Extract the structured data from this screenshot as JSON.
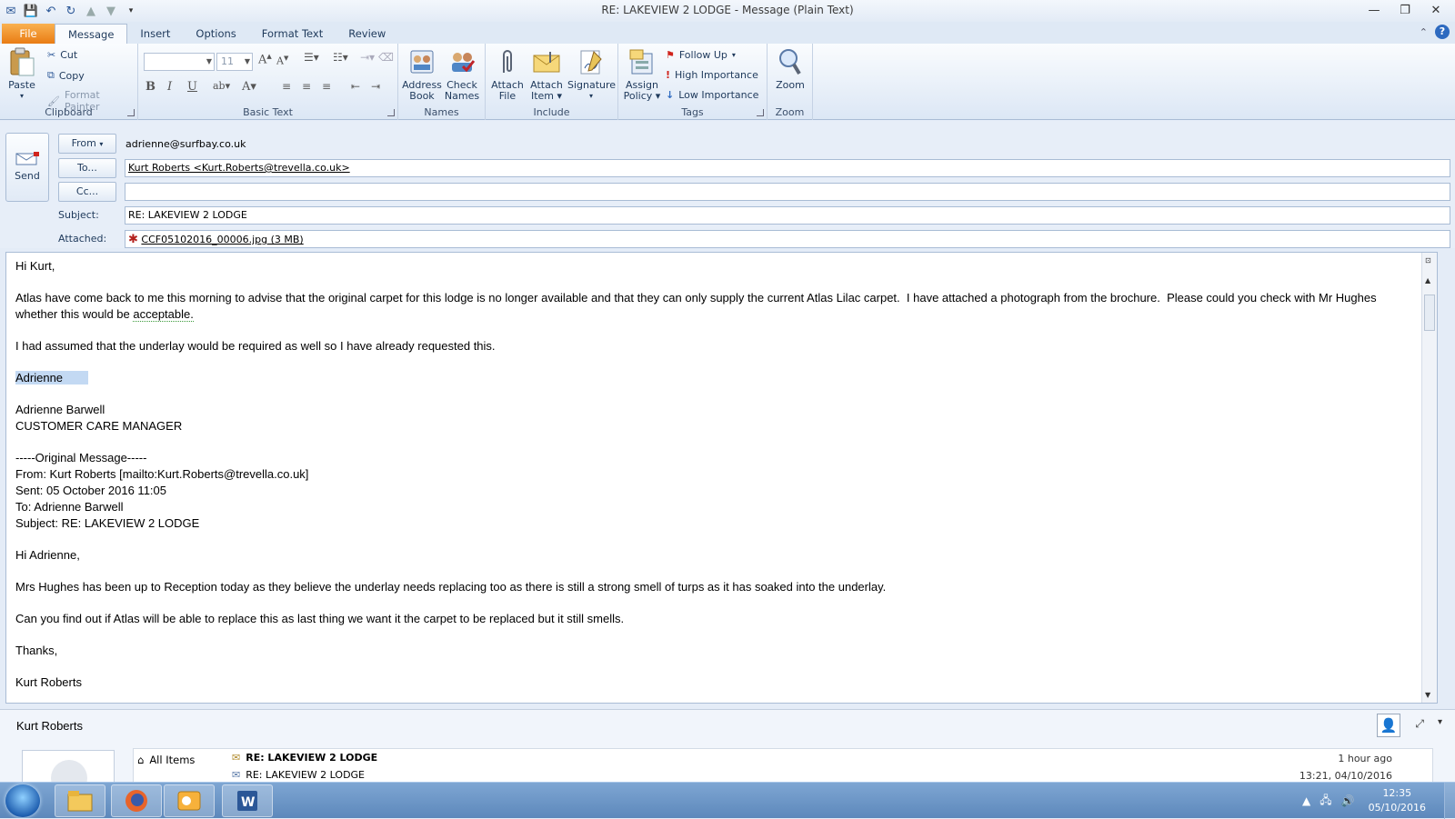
{
  "window": {
    "title": "RE: LAKEVIEW 2 LODGE  -  Message (Plain Text)"
  },
  "tabs": [
    "File",
    "Message",
    "Insert",
    "Options",
    "Format Text",
    "Review"
  ],
  "ribbon": {
    "clipboard": {
      "label": "Clipboard",
      "paste": "Paste",
      "cut": "Cut",
      "copy": "Copy",
      "format_painter": "Format Painter"
    },
    "basic_text": {
      "label": "Basic Text",
      "font_size": "11"
    },
    "names": {
      "label": "Names",
      "address_book": [
        "Address",
        "Book"
      ],
      "check_names": [
        "Check",
        "Names"
      ]
    },
    "include": {
      "label": "Include",
      "attach_file": [
        "Attach",
        "File"
      ],
      "attach_item": [
        "Attach",
        "Item"
      ],
      "signature": "Signature"
    },
    "tags": {
      "label": "Tags",
      "assign_policy": [
        "Assign",
        "Policy"
      ],
      "follow_up": "Follow Up",
      "high_importance": "High Importance",
      "low_importance": "Low Importance"
    },
    "zoom": {
      "label": "Zoom",
      "zoom": "Zoom"
    }
  },
  "header": {
    "send": "Send",
    "from_button": "From",
    "from_value": "adrienne@surfbay.co.uk",
    "to_button": "To...",
    "to_value": "Kurt Roberts <Kurt.Roberts@trevella.co.uk>",
    "cc_button": "Cc...",
    "cc_value": "",
    "subject_label": "Subject:",
    "subject_value": "RE: LAKEVIEW 2 LODGE",
    "attached_label": "Attached:",
    "attachment": "CCF05102016_00006.jpg (3 MB)"
  },
  "body": {
    "greeting": "Hi Kurt,",
    "para1_a": "Atlas have come back to me this morning to advise that the original carpet for this lodge is no longer available and that they can only supply the current Atlas Lilac carpet.  I have attached a photograph from the brochure.  Please could you check with Mr Hughes whether this would be ",
    "para1_b": "acceptable.",
    "para2": "I had assumed that the underlay would be required as well so I have already requested this.",
    "signoff": "Adrienne",
    "sig_name": "Adrienne Barwell",
    "sig_title": "CUSTOMER CARE MANAGER",
    "orig_header": "-----Original Message-----",
    "orig_from": "From: Kurt Roberts [mailto:Kurt.Roberts@trevella.co.uk]",
    "orig_sent": "Sent: 05 October 2016 11:05",
    "orig_to": "To: Adrienne Barwell",
    "orig_subject": "Subject: RE: LAKEVIEW 2 LODGE",
    "orig_greeting": "Hi Adrienne,",
    "orig_para1": "Mrs Hughes has been up to Reception today as they believe the underlay needs replacing too as there is still a strong smell of turps as it has soaked into the underlay.",
    "orig_para2": "Can you find out if Atlas will be able to replace this as last thing we want it the carpet to be replaced but it still smells.",
    "orig_thanks": "Thanks,",
    "orig_name": "Kurt Roberts"
  },
  "people_pane": {
    "name": "Kurt Roberts",
    "filter": "All Items",
    "items": [
      {
        "subject": "RE: LAKEVIEW 2 LODGE",
        "time": "1 hour ago"
      },
      {
        "subject": "RE: LAKEVIEW 2 LODGE",
        "time": "13:21, 04/10/2016"
      }
    ]
  },
  "taskbar": {
    "time": "12:35",
    "date": "05/10/2016"
  }
}
